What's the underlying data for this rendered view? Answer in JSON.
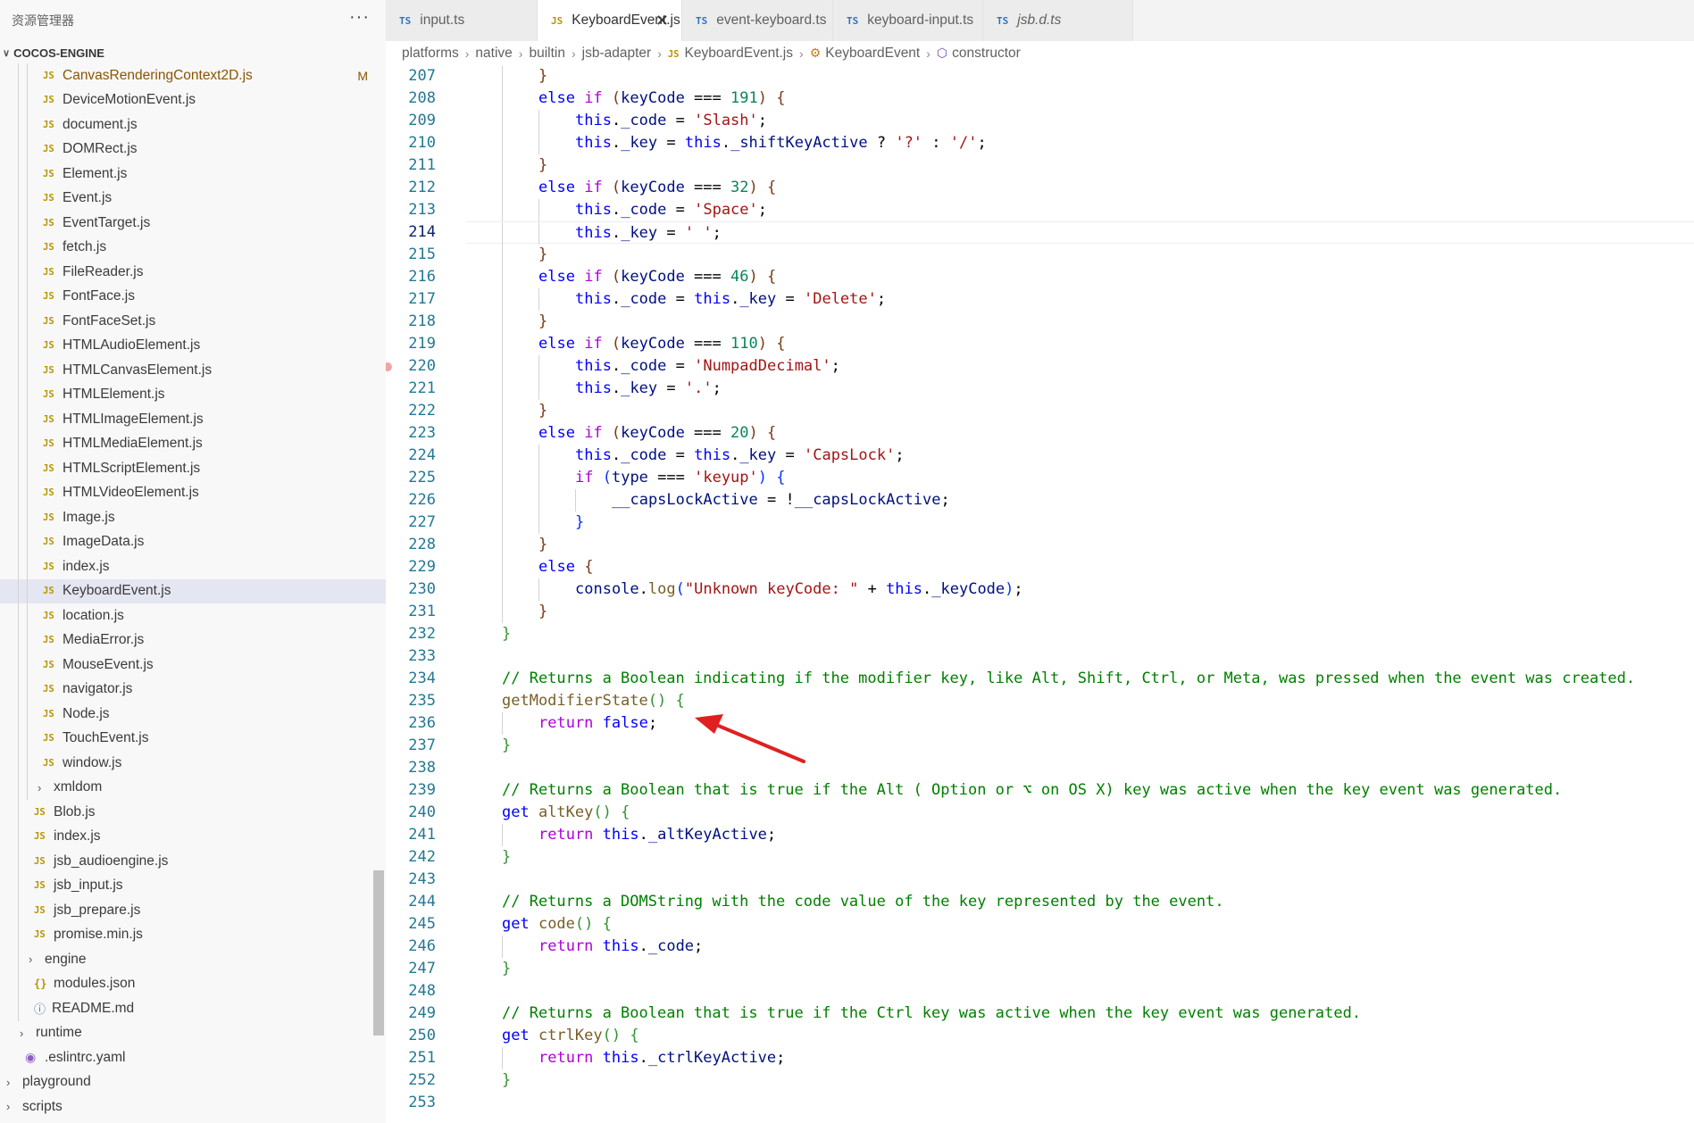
{
  "sidebar": {
    "title": "资源管理器",
    "more": "···",
    "root": "COCOS-ENGINE",
    "items": [
      {
        "icon": "js",
        "name": "CanvasRenderingContext2D.js",
        "indent": 2,
        "status": "M"
      },
      {
        "icon": "js",
        "name": "DeviceMotionEvent.js",
        "indent": 2
      },
      {
        "icon": "js",
        "name": "document.js",
        "indent": 2
      },
      {
        "icon": "js",
        "name": "DOMRect.js",
        "indent": 2
      },
      {
        "icon": "js",
        "name": "Element.js",
        "indent": 2
      },
      {
        "icon": "js",
        "name": "Event.js",
        "indent": 2
      },
      {
        "icon": "js",
        "name": "EventTarget.js",
        "indent": 2
      },
      {
        "icon": "js",
        "name": "fetch.js",
        "indent": 2
      },
      {
        "icon": "js",
        "name": "FileReader.js",
        "indent": 2
      },
      {
        "icon": "js",
        "name": "FontFace.js",
        "indent": 2
      },
      {
        "icon": "js",
        "name": "FontFaceSet.js",
        "indent": 2
      },
      {
        "icon": "js",
        "name": "HTMLAudioElement.js",
        "indent": 2
      },
      {
        "icon": "js",
        "name": "HTMLCanvasElement.js",
        "indent": 2
      },
      {
        "icon": "js",
        "name": "HTMLElement.js",
        "indent": 2
      },
      {
        "icon": "js",
        "name": "HTMLImageElement.js",
        "indent": 2
      },
      {
        "icon": "js",
        "name": "HTMLMediaElement.js",
        "indent": 2
      },
      {
        "icon": "js",
        "name": "HTMLScriptElement.js",
        "indent": 2
      },
      {
        "icon": "js",
        "name": "HTMLVideoElement.js",
        "indent": 2
      },
      {
        "icon": "js",
        "name": "Image.js",
        "indent": 2
      },
      {
        "icon": "js",
        "name": "ImageData.js",
        "indent": 2
      },
      {
        "icon": "js",
        "name": "index.js",
        "indent": 2
      },
      {
        "icon": "js",
        "name": "KeyboardEvent.js",
        "indent": 2,
        "selected": true
      },
      {
        "icon": "js",
        "name": "location.js",
        "indent": 2
      },
      {
        "icon": "js",
        "name": "MediaError.js",
        "indent": 2
      },
      {
        "icon": "js",
        "name": "MouseEvent.js",
        "indent": 2
      },
      {
        "icon": "js",
        "name": "navigator.js",
        "indent": 2
      },
      {
        "icon": "js",
        "name": "Node.js",
        "indent": 2
      },
      {
        "icon": "js",
        "name": "TouchEvent.js",
        "indent": 2
      },
      {
        "icon": "js",
        "name": "window.js",
        "indent": 2
      },
      {
        "icon": "folder",
        "name": "xmldom",
        "indent": 2
      },
      {
        "icon": "js",
        "name": "Blob.js",
        "indent": 1
      },
      {
        "icon": "js",
        "name": "index.js",
        "indent": 1
      },
      {
        "icon": "js",
        "name": "jsb_audioengine.js",
        "indent": 1
      },
      {
        "icon": "js",
        "name": "jsb_input.js",
        "indent": 1
      },
      {
        "icon": "js",
        "name": "jsb_prepare.js",
        "indent": 1
      },
      {
        "icon": "js",
        "name": "promise.min.js",
        "indent": 1
      },
      {
        "icon": "folder",
        "name": "engine",
        "indent": 1
      },
      {
        "icon": "json",
        "name": "modules.json",
        "indent": 1
      },
      {
        "icon": "info",
        "name": "README.md",
        "indent": 1
      },
      {
        "icon": "folder",
        "name": "runtime",
        "indent": 0
      },
      {
        "icon": "yaml",
        "name": ".eslintrc.yaml",
        "indent": 0
      },
      {
        "icon": "folder",
        "name": "playground",
        "indent": -1
      },
      {
        "icon": "folder",
        "name": "scripts",
        "indent": -1
      }
    ]
  },
  "tabs": [
    {
      "icon": "TS",
      "label": "input.ts",
      "active": false
    },
    {
      "icon": "JS",
      "label": "KeyboardEvent.js",
      "active": true,
      "close": "✕"
    },
    {
      "icon": "TS",
      "label": "event-keyboard.ts",
      "active": false
    },
    {
      "icon": "TS",
      "label": "keyboard-input.ts",
      "active": false
    },
    {
      "icon": "TS",
      "label": "jsb.d.ts",
      "active": false,
      "italic": true
    }
  ],
  "breadcrumb": {
    "parts": [
      "platforms",
      "native",
      "builtin",
      "jsb-adapter"
    ],
    "file": "KeyboardEvent.js",
    "class_name": "KeyboardEvent",
    "method": "constructor"
  },
  "editor": {
    "current_line": 214,
    "breakpoint_line": 220,
    "lines": [
      {
        "n": 207,
        "i": 1,
        "t": [
          [
            "}",
            "b3"
          ]
        ]
      },
      {
        "n": 208,
        "i": 1,
        "t": [
          [
            "else ",
            "k"
          ],
          [
            "if ",
            "kc"
          ],
          [
            "(",
            "b3"
          ],
          [
            "keyCode",
            "v"
          ],
          [
            " === ",
            "p"
          ],
          [
            "191",
            "n"
          ],
          [
            ") ",
            "b3"
          ],
          [
            "{",
            "b3"
          ]
        ]
      },
      {
        "n": 209,
        "i": 2,
        "t": [
          [
            "this",
            "k"
          ],
          [
            ".",
            "p"
          ],
          [
            "_code",
            "v"
          ],
          [
            " = ",
            "p"
          ],
          [
            "'Slash'",
            "s"
          ],
          [
            ";",
            "p"
          ]
        ]
      },
      {
        "n": 210,
        "i": 2,
        "t": [
          [
            "this",
            "k"
          ],
          [
            ".",
            "p"
          ],
          [
            "_key",
            "v"
          ],
          [
            " = ",
            "p"
          ],
          [
            "this",
            "k"
          ],
          [
            ".",
            "p"
          ],
          [
            "_shiftKeyActive",
            "v"
          ],
          [
            " ? ",
            "p"
          ],
          [
            "'?'",
            "s"
          ],
          [
            " : ",
            "p"
          ],
          [
            "'/'",
            "s"
          ],
          [
            ";",
            "p"
          ]
        ]
      },
      {
        "n": 211,
        "i": 1,
        "t": [
          [
            "}",
            "b3"
          ]
        ]
      },
      {
        "n": 212,
        "i": 1,
        "t": [
          [
            "else ",
            "k"
          ],
          [
            "if ",
            "kc"
          ],
          [
            "(",
            "b3"
          ],
          [
            "keyCode",
            "v"
          ],
          [
            " === ",
            "p"
          ],
          [
            "32",
            "n"
          ],
          [
            ") ",
            "b3"
          ],
          [
            "{",
            "b3"
          ]
        ]
      },
      {
        "n": 213,
        "i": 2,
        "t": [
          [
            "this",
            "k"
          ],
          [
            ".",
            "p"
          ],
          [
            "_code",
            "v"
          ],
          [
            " = ",
            "p"
          ],
          [
            "'Space'",
            "s"
          ],
          [
            ";",
            "p"
          ]
        ]
      },
      {
        "n": 214,
        "i": 2,
        "t": [
          [
            "this",
            "k"
          ],
          [
            ".",
            "p"
          ],
          [
            "_key",
            "v"
          ],
          [
            " = ",
            "p"
          ],
          [
            "' '",
            "s"
          ],
          [
            ";",
            "p"
          ]
        ]
      },
      {
        "n": 215,
        "i": 1,
        "t": [
          [
            "}",
            "b3"
          ]
        ]
      },
      {
        "n": 216,
        "i": 1,
        "t": [
          [
            "else ",
            "k"
          ],
          [
            "if ",
            "kc"
          ],
          [
            "(",
            "b3"
          ],
          [
            "keyCode",
            "v"
          ],
          [
            " === ",
            "p"
          ],
          [
            "46",
            "n"
          ],
          [
            ") ",
            "b3"
          ],
          [
            "{",
            "b3"
          ]
        ]
      },
      {
        "n": 217,
        "i": 2,
        "t": [
          [
            "this",
            "k"
          ],
          [
            ".",
            "p"
          ],
          [
            "_code",
            "v"
          ],
          [
            " = ",
            "p"
          ],
          [
            "this",
            "k"
          ],
          [
            ".",
            "p"
          ],
          [
            "_key",
            "v"
          ],
          [
            " = ",
            "p"
          ],
          [
            "'Delete'",
            "s"
          ],
          [
            ";",
            "p"
          ]
        ]
      },
      {
        "n": 218,
        "i": 1,
        "t": [
          [
            "}",
            "b3"
          ]
        ]
      },
      {
        "n": 219,
        "i": 1,
        "t": [
          [
            "else ",
            "k"
          ],
          [
            "if ",
            "kc"
          ],
          [
            "(",
            "b3"
          ],
          [
            "keyCode",
            "v"
          ],
          [
            " === ",
            "p"
          ],
          [
            "110",
            "n"
          ],
          [
            ") ",
            "b3"
          ],
          [
            "{",
            "b3"
          ]
        ]
      },
      {
        "n": 220,
        "i": 2,
        "t": [
          [
            "this",
            "k"
          ],
          [
            ".",
            "p"
          ],
          [
            "_code",
            "v"
          ],
          [
            " = ",
            "p"
          ],
          [
            "'NumpadDecimal'",
            "s"
          ],
          [
            ";",
            "p"
          ]
        ]
      },
      {
        "n": 221,
        "i": 2,
        "t": [
          [
            "this",
            "k"
          ],
          [
            ".",
            "p"
          ],
          [
            "_key",
            "v"
          ],
          [
            " = ",
            "p"
          ],
          [
            "'.'",
            "s"
          ],
          [
            ";",
            "p"
          ]
        ]
      },
      {
        "n": 222,
        "i": 1,
        "t": [
          [
            "}",
            "b3"
          ]
        ]
      },
      {
        "n": 223,
        "i": 1,
        "t": [
          [
            "else ",
            "k"
          ],
          [
            "if ",
            "kc"
          ],
          [
            "(",
            "b3"
          ],
          [
            "keyCode",
            "v"
          ],
          [
            " === ",
            "p"
          ],
          [
            "20",
            "n"
          ],
          [
            ") ",
            "b3"
          ],
          [
            "{",
            "b3"
          ]
        ]
      },
      {
        "n": 224,
        "i": 2,
        "t": [
          [
            "this",
            "k"
          ],
          [
            ".",
            "p"
          ],
          [
            "_code",
            "v"
          ],
          [
            " = ",
            "p"
          ],
          [
            "this",
            "k"
          ],
          [
            ".",
            "p"
          ],
          [
            "_key",
            "v"
          ],
          [
            " = ",
            "p"
          ],
          [
            "'CapsLock'",
            "s"
          ],
          [
            ";",
            "p"
          ]
        ]
      },
      {
        "n": 225,
        "i": 2,
        "t": [
          [
            "if ",
            "kc"
          ],
          [
            "(",
            "b1"
          ],
          [
            "type",
            "v"
          ],
          [
            " === ",
            "p"
          ],
          [
            "'keyup'",
            "s"
          ],
          [
            ") ",
            "b1"
          ],
          [
            "{",
            "b1"
          ]
        ]
      },
      {
        "n": 226,
        "i": 3,
        "t": [
          [
            "__capsLockActive",
            "v"
          ],
          [
            " = !",
            "p"
          ],
          [
            "__capsLockActive",
            "v"
          ],
          [
            ";",
            "p"
          ]
        ]
      },
      {
        "n": 227,
        "i": 2,
        "t": [
          [
            "}",
            "b1"
          ]
        ]
      },
      {
        "n": 228,
        "i": 1,
        "t": [
          [
            "}",
            "b3"
          ]
        ]
      },
      {
        "n": 229,
        "i": 1,
        "t": [
          [
            "else ",
            "k"
          ],
          [
            "{",
            "b3"
          ]
        ]
      },
      {
        "n": 230,
        "i": 2,
        "t": [
          [
            "console",
            "v"
          ],
          [
            ".",
            "p"
          ],
          [
            "log",
            "f"
          ],
          [
            "(",
            "b1"
          ],
          [
            "\"Unknown keyCode: \"",
            "s"
          ],
          [
            " + ",
            "p"
          ],
          [
            "this",
            "k"
          ],
          [
            ".",
            "p"
          ],
          [
            "_keyCode",
            "v"
          ],
          [
            ")",
            "b1"
          ],
          [
            ";",
            "p"
          ]
        ]
      },
      {
        "n": 231,
        "i": 1,
        "t": [
          [
            "}",
            "b3"
          ]
        ]
      },
      {
        "n": 232,
        "i": 0,
        "t": [
          [
            "}",
            "b2"
          ]
        ]
      },
      {
        "n": 233,
        "i": 0,
        "t": []
      },
      {
        "n": 234,
        "i": 0,
        "t": [
          [
            "// Returns a Boolean indicating if the modifier key, like Alt, Shift, Ctrl, or Meta, was pressed when the event was created.",
            "c"
          ]
        ]
      },
      {
        "n": 235,
        "i": 0,
        "t": [
          [
            "getModifierState",
            "f"
          ],
          [
            "() ",
            "b2"
          ],
          [
            "{",
            "b2"
          ]
        ]
      },
      {
        "n": 236,
        "i": 1,
        "t": [
          [
            "return ",
            "kc"
          ],
          [
            "false",
            "k"
          ],
          [
            ";",
            "p"
          ]
        ]
      },
      {
        "n": 237,
        "i": 0,
        "t": [
          [
            "}",
            "b2"
          ]
        ]
      },
      {
        "n": 238,
        "i": 0,
        "t": []
      },
      {
        "n": 239,
        "i": 0,
        "t": [
          [
            "// Returns a Boolean that is true if the Alt ( Option or ⌥ on OS X) key was active when the key event was generated.",
            "c"
          ]
        ]
      },
      {
        "n": 240,
        "i": 0,
        "t": [
          [
            "get ",
            "k"
          ],
          [
            "altKey",
            "f"
          ],
          [
            "() ",
            "b2"
          ],
          [
            "{",
            "b2"
          ]
        ]
      },
      {
        "n": 241,
        "i": 1,
        "t": [
          [
            "return ",
            "kc"
          ],
          [
            "this",
            "k"
          ],
          [
            ".",
            "p"
          ],
          [
            "_altKeyActive",
            "v"
          ],
          [
            ";",
            "p"
          ]
        ]
      },
      {
        "n": 242,
        "i": 0,
        "t": [
          [
            "}",
            "b2"
          ]
        ]
      },
      {
        "n": 243,
        "i": 0,
        "t": []
      },
      {
        "n": 244,
        "i": 0,
        "t": [
          [
            "// Returns a DOMString with the code value of the key represented by the event.",
            "c"
          ]
        ]
      },
      {
        "n": 245,
        "i": 0,
        "t": [
          [
            "get ",
            "k"
          ],
          [
            "code",
            "f"
          ],
          [
            "() ",
            "b2"
          ],
          [
            "{",
            "b2"
          ]
        ]
      },
      {
        "n": 246,
        "i": 1,
        "t": [
          [
            "return ",
            "kc"
          ],
          [
            "this",
            "k"
          ],
          [
            ".",
            "p"
          ],
          [
            "_code",
            "v"
          ],
          [
            ";",
            "p"
          ]
        ]
      },
      {
        "n": 247,
        "i": 0,
        "t": [
          [
            "}",
            "b2"
          ]
        ]
      },
      {
        "n": 248,
        "i": 0,
        "t": []
      },
      {
        "n": 249,
        "i": 0,
        "t": [
          [
            "// Returns a Boolean that is true if the Ctrl key was active when the key event was generated.",
            "c"
          ]
        ]
      },
      {
        "n": 250,
        "i": 0,
        "t": [
          [
            "get ",
            "k"
          ],
          [
            "ctrlKey",
            "f"
          ],
          [
            "() ",
            "b2"
          ],
          [
            "{",
            "b2"
          ]
        ]
      },
      {
        "n": 251,
        "i": 1,
        "t": [
          [
            "return ",
            "kc"
          ],
          [
            "this",
            "k"
          ],
          [
            ".",
            "p"
          ],
          [
            "_ctrlKeyActive",
            "v"
          ],
          [
            ";",
            "p"
          ]
        ]
      },
      {
        "n": 252,
        "i": 0,
        "t": [
          [
            "}",
            "b2"
          ]
        ]
      },
      {
        "n": 253,
        "i": 0,
        "t": []
      }
    ]
  },
  "annotation": {
    "arrow_color": "#e02020",
    "points_to_line": 235
  }
}
